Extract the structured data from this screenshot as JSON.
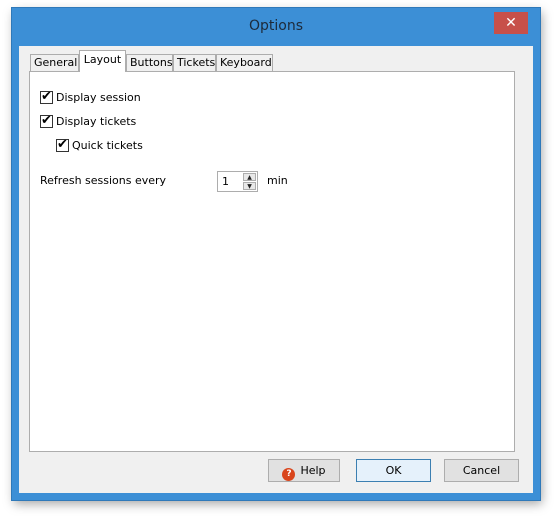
{
  "window": {
    "title": "Options",
    "close_glyph": "✕"
  },
  "tabs": [
    {
      "label": "General"
    },
    {
      "label": "Layout"
    },
    {
      "label": "Buttons"
    },
    {
      "label": "Tickets"
    },
    {
      "label": "Keyboard"
    }
  ],
  "active_tab": "Layout",
  "layout": {
    "display_session": {
      "label": "Display session",
      "checked": true
    },
    "display_tickets": {
      "label": "Display tickets",
      "checked": true
    },
    "quick_tickets": {
      "label": "Quick tickets",
      "checked": true
    },
    "refresh": {
      "label": "Refresh sessions every",
      "value": "1",
      "unit": "min"
    }
  },
  "buttons": {
    "help": "Help",
    "ok": "OK",
    "cancel": "Cancel"
  },
  "icons": {
    "check": "✔",
    "help": "?",
    "spin_up": "▲",
    "spin_down": "▼"
  }
}
